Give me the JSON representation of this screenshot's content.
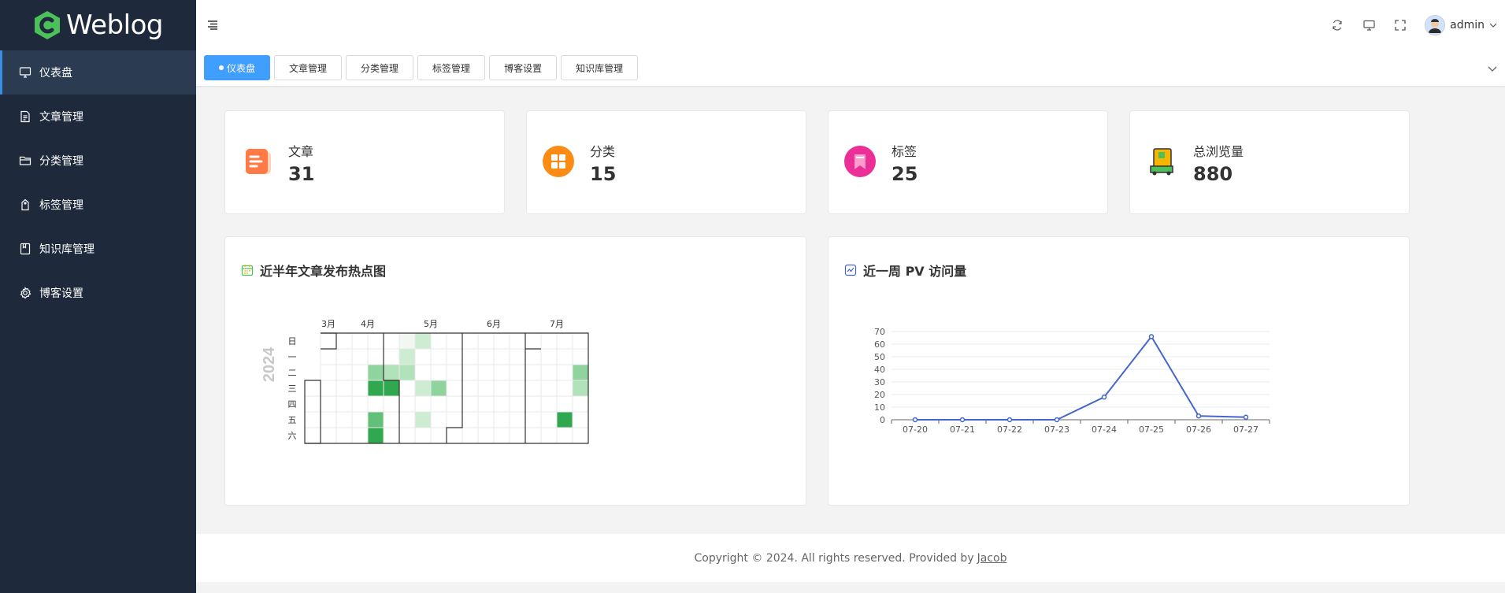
{
  "brand": {
    "name": "Weblog",
    "color": "#4cc15a"
  },
  "sidebar": {
    "items": [
      {
        "label": "仪表盘",
        "icon": "monitor-icon"
      },
      {
        "label": "文章管理",
        "icon": "document-icon"
      },
      {
        "label": "分类管理",
        "icon": "folder-icon"
      },
      {
        "label": "标签管理",
        "icon": "tag-icon"
      },
      {
        "label": "知识库管理",
        "icon": "book-icon"
      },
      {
        "label": "博客设置",
        "icon": "gear-icon"
      }
    ]
  },
  "header": {
    "username": "admin"
  },
  "tabs": [
    {
      "label": "仪表盘"
    },
    {
      "label": "文章管理"
    },
    {
      "label": "分类管理"
    },
    {
      "label": "标签管理"
    },
    {
      "label": "博客设置"
    },
    {
      "label": "知识库管理"
    }
  ],
  "stats": [
    {
      "label": "文章",
      "value": "31",
      "icon": "article-icon",
      "color": "#ff7a45"
    },
    {
      "label": "分类",
      "value": "15",
      "icon": "category-icon",
      "color": "#fa8c16"
    },
    {
      "label": "标签",
      "value": "25",
      "icon": "tag-icon",
      "color": "#eb2f96"
    },
    {
      "label": "总浏览量",
      "value": "880",
      "icon": "pv-icon",
      "color": "#f7b500"
    }
  ],
  "heatmap": {
    "title": "近半年文章发布热点图",
    "year": "2024",
    "months": [
      "3月",
      "4月",
      "5月",
      "6月",
      "7月"
    ],
    "weekdays": [
      "日",
      "一",
      "二",
      "三",
      "四",
      "五",
      "六"
    ]
  },
  "pv": {
    "title": "近一周 PV 访问量"
  },
  "chart_data": {
    "type": "line",
    "x": [
      "07-20",
      "07-21",
      "07-22",
      "07-23",
      "07-24",
      "07-25",
      "07-26",
      "07-27"
    ],
    "values": [
      0,
      0,
      0,
      0,
      18,
      66,
      3,
      2
    ],
    "ylim": [
      0,
      70
    ],
    "yticks": [
      "0",
      "10",
      "20",
      "30",
      "40",
      "50",
      "60",
      "70"
    ],
    "grid": true,
    "color": "#4466cc"
  },
  "footer": {
    "text": "Copyright © 2024. All rights reserved. Provided by",
    "link": "Jacob"
  }
}
